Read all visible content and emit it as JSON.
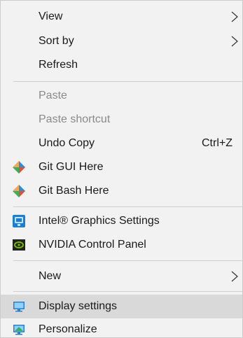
{
  "menu": {
    "items": {
      "view": {
        "label": "View"
      },
      "sort_by": {
        "label": "Sort by"
      },
      "refresh": {
        "label": "Refresh"
      },
      "paste": {
        "label": "Paste"
      },
      "paste_shortcut": {
        "label": "Paste shortcut"
      },
      "undo_copy": {
        "label": "Undo Copy",
        "shortcut": "Ctrl+Z"
      },
      "git_gui": {
        "label": "Git GUI Here",
        "icon": "git-diamond-icon"
      },
      "git_bash": {
        "label": "Git Bash Here",
        "icon": "git-diamond-icon"
      },
      "intel_graphics": {
        "label": "Intel® Graphics Settings",
        "icon": "intel-graphics-icon"
      },
      "nvidia": {
        "label": "NVIDIA Control Panel",
        "icon": "nvidia-icon"
      },
      "new": {
        "label": "New"
      },
      "display_settings": {
        "label": "Display settings",
        "icon": "monitor-icon",
        "highlighted": true
      },
      "personalize": {
        "label": "Personalize",
        "icon": "personalize-monitor-icon"
      }
    }
  },
  "colors": {
    "menu_background": "#f2f2f2",
    "hover_background": "#d9d9d9",
    "disabled_text": "#8a8a8a",
    "separator": "#cfcfcf"
  }
}
